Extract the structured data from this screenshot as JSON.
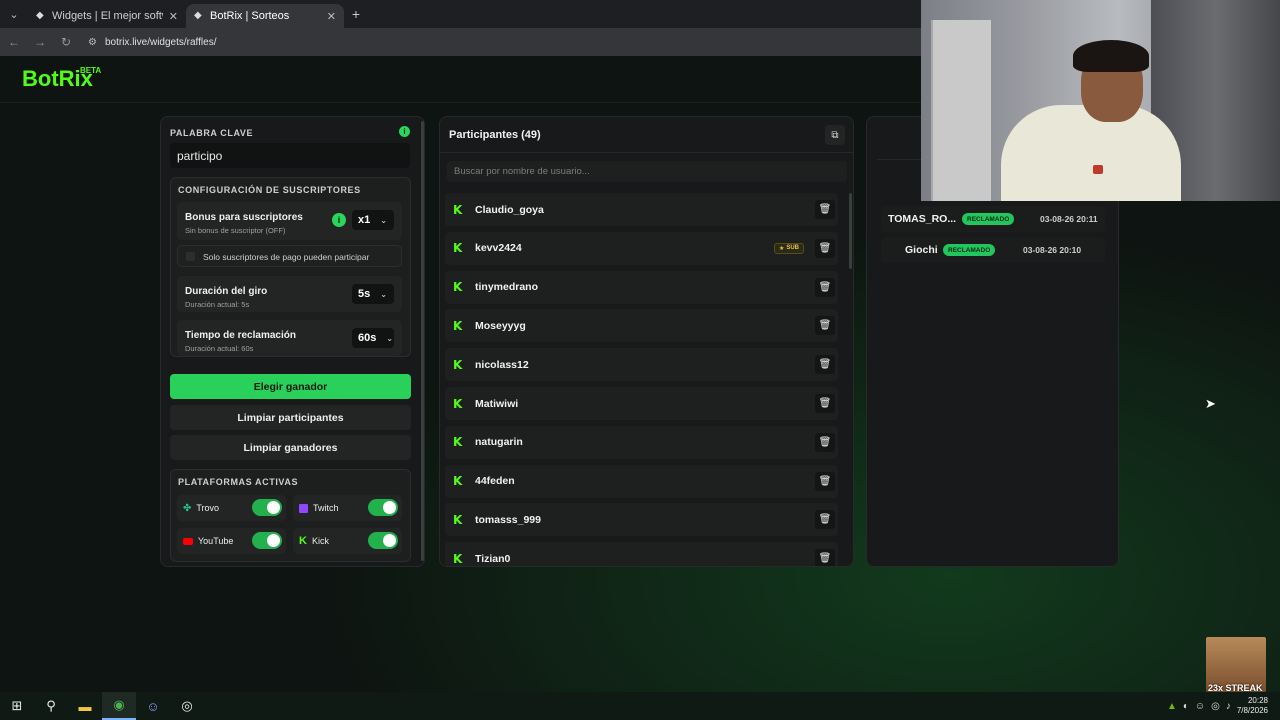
{
  "browser": {
    "tabs": [
      {
        "title": "Widgets | El mejor software para",
        "active": false
      },
      {
        "title": "BotRix | Sorteos",
        "active": true
      }
    ],
    "url": "botrix.live/widgets/raffles/"
  },
  "brand": {
    "name": "BotRix",
    "badge": "BETA"
  },
  "config": {
    "keyword_label": "PALABRA CLAVE",
    "keyword_value": "participo",
    "subs_section_label": "CONFIGURACIÓN DE SUSCRIPTORES",
    "bonus": {
      "title": "Bonus para suscriptores",
      "subtitle": "Sin bonus de suscriptor (OFF)",
      "value": "x1"
    },
    "subs_only_label": "Solo suscriptores de pago pueden participar",
    "spin": {
      "title": "Duración del giro",
      "subtitle": "Duración actual: 5s",
      "value": "5s"
    },
    "claim": {
      "title": "Tiempo de reclamación",
      "subtitle": "Duración actual: 60s",
      "value": "60s"
    },
    "buttons": {
      "pick": "Elegir ganador",
      "clear_participants": "Limpiar participantes",
      "clear_winners": "Limpiar ganadores"
    },
    "platforms_label": "PLATAFORMAS ACTIVAS",
    "platforms": [
      {
        "name": "Trovo",
        "enabled": true
      },
      {
        "name": "Twitch",
        "enabled": true
      },
      {
        "name": "YouTube",
        "enabled": true
      },
      {
        "name": "Kick",
        "enabled": true
      }
    ]
  },
  "participants": {
    "title": "Participantes (49)",
    "search_placeholder": "Buscar por nombre de usuario...",
    "list": [
      {
        "name": "Claudio_goya",
        "sub": false
      },
      {
        "name": "kevv2424",
        "sub": true
      },
      {
        "name": "tinymedrano",
        "sub": false
      },
      {
        "name": "Moseyyyg",
        "sub": false
      },
      {
        "name": "nicolass12",
        "sub": false
      },
      {
        "name": "Matiwiwi",
        "sub": false
      },
      {
        "name": "natugarin",
        "sub": false
      },
      {
        "name": "44feden",
        "sub": false
      },
      {
        "name": "tomasss_999",
        "sub": false
      },
      {
        "name": "Tizian0",
        "sub": false
      }
    ],
    "sub_badge": "SUB"
  },
  "winners": [
    {
      "name": "TOMAS_RO...",
      "status": "RECLAMADO",
      "time": "03-08-26 20:11"
    },
    {
      "name": "Giochi",
      "status": "RECLAMADO",
      "time": "03-08-26 20:10"
    }
  ],
  "overlay": {
    "streak": "23x STREAK"
  },
  "taskbar": {
    "time": "20:28",
    "date": "7/8/2026"
  },
  "colors": {
    "accent": "#53fc18",
    "button_green": "#29d05a",
    "badge_green": "#22c55e"
  }
}
